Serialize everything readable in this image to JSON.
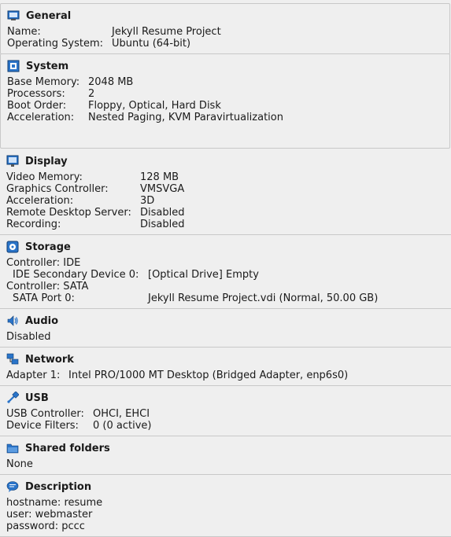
{
  "general": {
    "title": "General",
    "rows": [
      {
        "key": "Name:",
        "value": "Jekyll Resume Project"
      },
      {
        "key": "Operating System:",
        "value": "Ubuntu (64-bit)"
      }
    ]
  },
  "system": {
    "title": "System",
    "rows": [
      {
        "key": "Base Memory:",
        "value": "2048 MB"
      },
      {
        "key": "Processors:",
        "value": "2"
      },
      {
        "key": "Boot Order:",
        "value": "Floppy, Optical, Hard Disk"
      },
      {
        "key": "Acceleration:",
        "value": "Nested Paging, KVM Paravirtualization"
      }
    ]
  },
  "display": {
    "title": "Display",
    "rows": [
      {
        "key": "Video Memory:",
        "value": "128 MB"
      },
      {
        "key": "Graphics Controller:",
        "value": "VMSVGA"
      },
      {
        "key": "Acceleration:",
        "value": "3D"
      },
      {
        "key": "Remote Desktop Server:",
        "value": "Disabled"
      },
      {
        "key": "Recording:",
        "value": "Disabled"
      }
    ]
  },
  "storage": {
    "title": "Storage",
    "rows": [
      {
        "key": "Controller: IDE",
        "value": ""
      },
      {
        "key": "IDE Secondary Device 0:",
        "value": "[Optical Drive] Empty"
      },
      {
        "key": "Controller: SATA",
        "value": ""
      },
      {
        "key": "SATA Port 0:",
        "value": "Jekyll Resume Project.vdi (Normal, 50.00 GB)"
      }
    ]
  },
  "audio": {
    "title": "Audio",
    "text": "Disabled"
  },
  "network": {
    "title": "Network",
    "rows": [
      {
        "key": "Adapter 1:",
        "value": "Intel PRO/1000 MT Desktop (Bridged Adapter, enp6s0)"
      }
    ]
  },
  "usb": {
    "title": "USB",
    "rows": [
      {
        "key": "USB Controller:",
        "value": "OHCI, EHCI"
      },
      {
        "key": "Device Filters:",
        "value": "0 (0 active)"
      }
    ]
  },
  "shared_folders": {
    "title": "Shared folders",
    "text": "None"
  },
  "description": {
    "title": "Description",
    "lines": [
      "hostname: resume",
      "user: webmaster",
      "password: pccc"
    ]
  },
  "icons": {
    "general": "monitor-icon",
    "system": "chip-icon",
    "display": "display-icon",
    "storage": "disk-icon",
    "audio": "speaker-icon",
    "network": "network-icon",
    "usb": "usb-icon",
    "shared_folders": "folder-icon",
    "description": "speech-bubble-icon"
  },
  "colors": {
    "icon_blue": "#2a74c9",
    "border": "#c8c8c8",
    "background": "#efefef"
  }
}
